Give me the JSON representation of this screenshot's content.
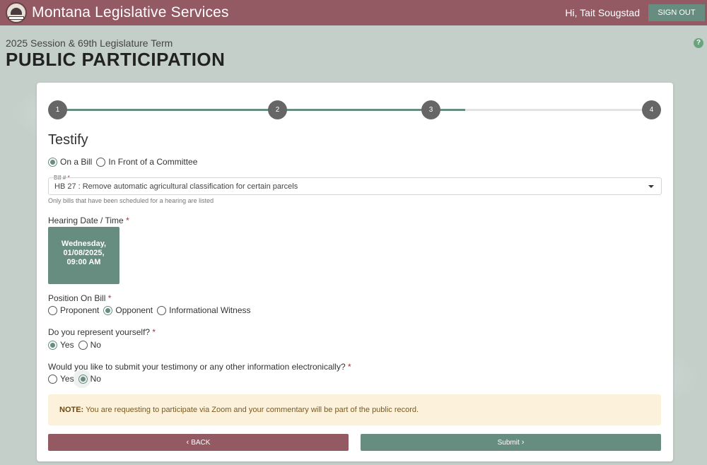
{
  "header": {
    "app_title": "Montana Legislative Services",
    "logo_text": "LEGISLATURE",
    "greeting": "Hi, Tait Sougstad",
    "sign_out_label": "SIGN OUT"
  },
  "page": {
    "subtitle": "2025 Session & 69th Legislature Term",
    "title": "PUBLIC PARTICIPATION",
    "help_label": "?"
  },
  "stepper": {
    "steps": [
      "1",
      "2",
      "3",
      "4"
    ],
    "current_step": 3
  },
  "form": {
    "section_title": "Testify",
    "testify_type": {
      "options": [
        "On a Bill",
        "In Front of a Committee"
      ],
      "selected": "On a Bill"
    },
    "bill": {
      "label": "Bill #",
      "required_mark": "*",
      "value": "HB 27 : Remove automatic agricultural classification for certain parcels",
      "hint": "Only bills that have been scheduled for a hearing are listed"
    },
    "hearing": {
      "label": "Hearing Date / Time",
      "required_mark": "*",
      "day": "Wednesday,",
      "date": "01/08/2025,",
      "time": "09:00 AM"
    },
    "position": {
      "label": "Position On Bill",
      "required_mark": "*",
      "options": [
        "Proponent",
        "Opponent",
        "Informational Witness"
      ],
      "selected": "Opponent"
    },
    "represent_self": {
      "label": "Do you represent yourself?",
      "required_mark": "*",
      "options": [
        "Yes",
        "No"
      ],
      "selected": "Yes"
    },
    "submit_electronically": {
      "label": "Would you like to submit your testimony or any other information electronically?",
      "required_mark": "*",
      "options": [
        "Yes",
        "No"
      ],
      "selected": "No"
    },
    "note": {
      "prefix": "NOTE:",
      "text": " You are requesting to participate via Zoom and your commentary will be part of the public record."
    },
    "back_label": "BACK",
    "submit_label": "Submit"
  },
  "colors": {
    "header_bg": "#935a63",
    "accent_green": "#678c80",
    "note_bg": "#fcf1db",
    "page_bg": "#c4cfca"
  },
  "icons": {
    "back": "chevron-left-icon",
    "submit": "chevron-right-icon",
    "dropdown": "caret-down-icon",
    "help": "help-circle-icon"
  }
}
